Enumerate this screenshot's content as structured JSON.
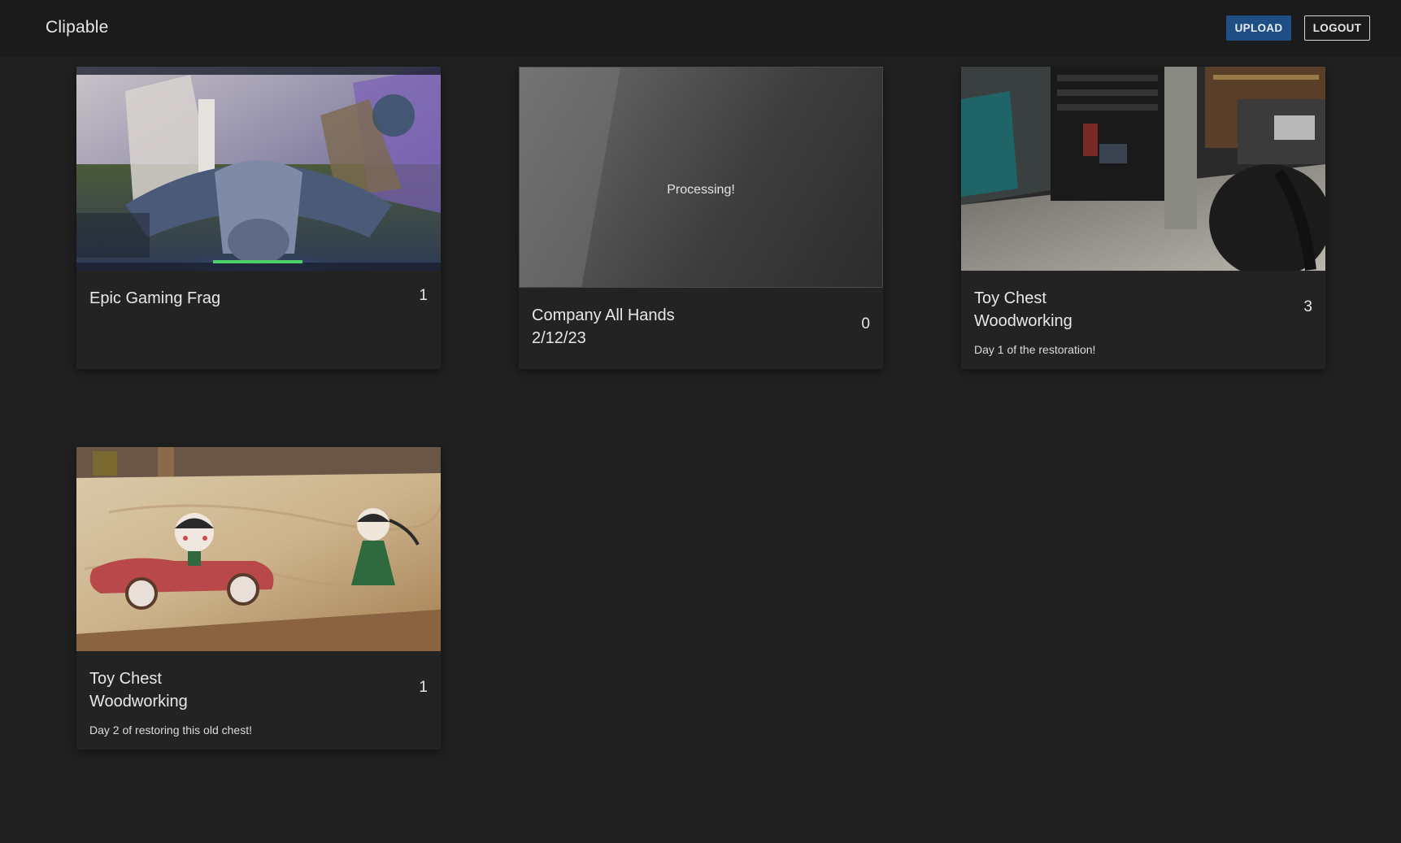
{
  "app": {
    "brand": "Clipable"
  },
  "header": {
    "upload_label": "UPLOAD",
    "logout_label": "LOGOUT",
    "accent_color": "#1f4e86"
  },
  "videos": [
    {
      "title": "Epic Gaming Frag",
      "count": "1",
      "description": "",
      "thumbnail": "game-screenshot"
    },
    {
      "title": "Company All Hands 2/12/23",
      "count": "0",
      "description": "",
      "status": "Processing!"
    },
    {
      "title": "Toy Chest Woodworking",
      "count": "3",
      "description": "Day 1 of the restoration!",
      "thumbnail": "garage-workshop"
    },
    {
      "title": "Toy Chest Woodworking",
      "count": "1",
      "description": "Day 2 of restoring this old chest!",
      "thumbnail": "painted-chest-lid"
    }
  ]
}
